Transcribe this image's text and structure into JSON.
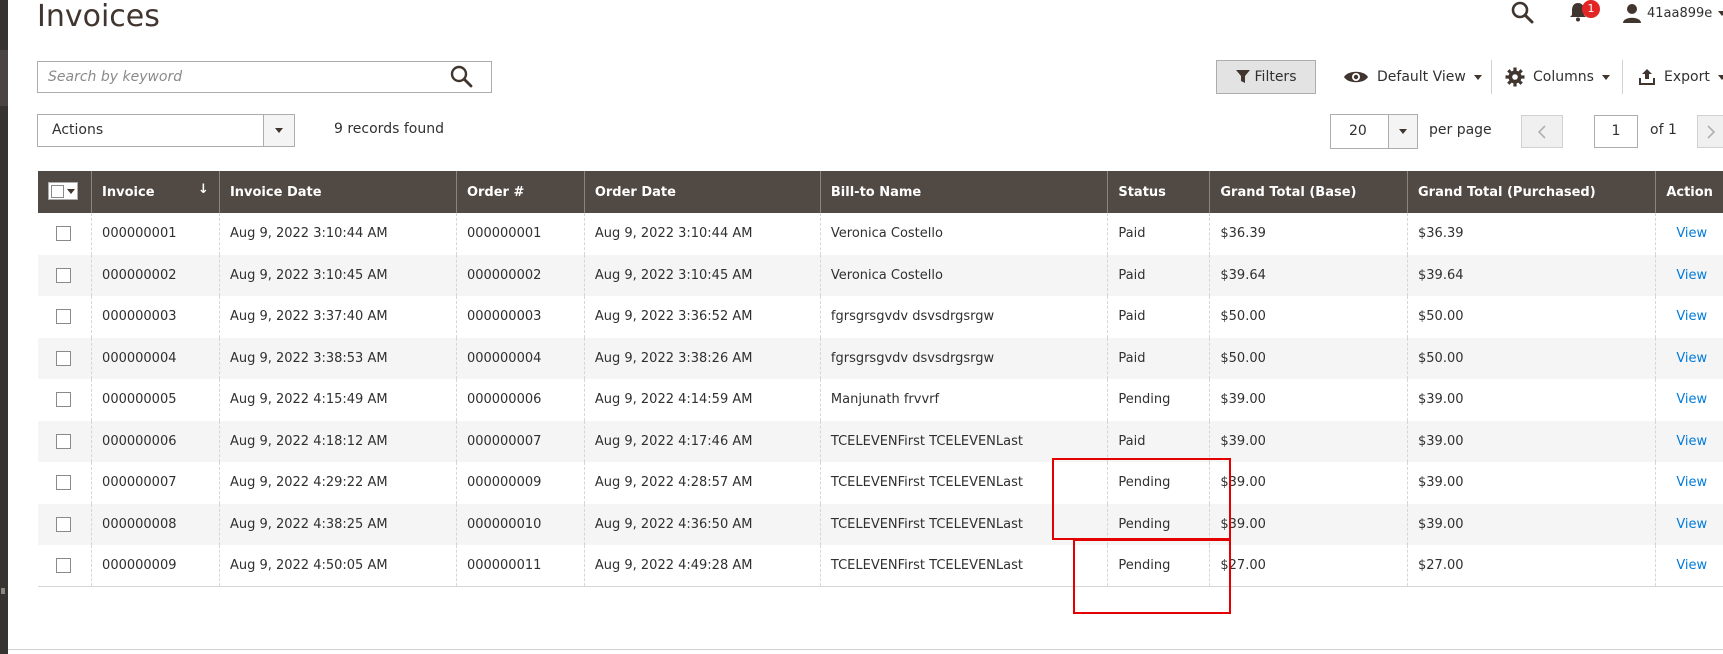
{
  "page": {
    "title": "Invoices"
  },
  "header": {
    "notification_count": "1",
    "user_name": "41aa899e"
  },
  "search": {
    "placeholder": "Search by keyword"
  },
  "toolbar": {
    "filters_label": "Filters",
    "view_label": "Default View",
    "columns_label": "Columns",
    "export_label": "Export"
  },
  "actions": {
    "label": "Actions"
  },
  "records_text": "9 records found",
  "pagination": {
    "per_page_value": "20",
    "per_page_label": "per page",
    "current_page": "1",
    "of_text": "of 1"
  },
  "columns": [
    "Invoice",
    "Invoice Date",
    "Order #",
    "Order Date",
    "Bill-to Name",
    "Status",
    "Grand Total (Base)",
    "Grand Total (Purchased)",
    "Action"
  ],
  "rows": [
    {
      "invoice": "000000001",
      "invoice_date": "Aug 9, 2022 3:10:44 AM",
      "order": "000000001",
      "order_date": "Aug 9, 2022 3:10:44 AM",
      "bill_to": "Veronica Costello",
      "status": "Paid",
      "total_base": "$36.39",
      "total_purchased": "$36.39",
      "action": "View"
    },
    {
      "invoice": "000000002",
      "invoice_date": "Aug 9, 2022 3:10:45 AM",
      "order": "000000002",
      "order_date": "Aug 9, 2022 3:10:45 AM",
      "bill_to": "Veronica Costello",
      "status": "Paid",
      "total_base": "$39.64",
      "total_purchased": "$39.64",
      "action": "View"
    },
    {
      "invoice": "000000003",
      "invoice_date": "Aug 9, 2022 3:37:40 AM",
      "order": "000000003",
      "order_date": "Aug 9, 2022 3:36:52 AM",
      "bill_to": "fgrsgrsgvdv dsvsdrgsrgw",
      "status": "Paid",
      "total_base": "$50.00",
      "total_purchased": "$50.00",
      "action": "View"
    },
    {
      "invoice": "000000004",
      "invoice_date": "Aug 9, 2022 3:38:53 AM",
      "order": "000000004",
      "order_date": "Aug 9, 2022 3:38:26 AM",
      "bill_to": "fgrsgrsgvdv dsvsdrgsrgw",
      "status": "Paid",
      "total_base": "$50.00",
      "total_purchased": "$50.00",
      "action": "View"
    },
    {
      "invoice": "000000005",
      "invoice_date": "Aug 9, 2022 4:15:49 AM",
      "order": "000000006",
      "order_date": "Aug 9, 2022 4:14:59 AM",
      "bill_to": "Manjunath frvvrf",
      "status": "Pending",
      "total_base": "$39.00",
      "total_purchased": "$39.00",
      "action": "View"
    },
    {
      "invoice": "000000006",
      "invoice_date": "Aug 9, 2022 4:18:12 AM",
      "order": "000000007",
      "order_date": "Aug 9, 2022 4:17:46 AM",
      "bill_to": "TCELEVENFirst TCELEVENLast",
      "status": "Paid",
      "total_base": "$39.00",
      "total_purchased": "$39.00",
      "action": "View"
    },
    {
      "invoice": "000000007",
      "invoice_date": "Aug 9, 2022 4:29:22 AM",
      "order": "000000009",
      "order_date": "Aug 9, 2022 4:28:57 AM",
      "bill_to": "TCELEVENFirst TCELEVENLast",
      "status": "Pending",
      "total_base": "$39.00",
      "total_purchased": "$39.00",
      "action": "View"
    },
    {
      "invoice": "000000008",
      "invoice_date": "Aug 9, 2022 4:38:25 AM",
      "order": "000000010",
      "order_date": "Aug 9, 2022 4:36:50 AM",
      "bill_to": "TCELEVENFirst TCELEVENLast",
      "status": "Pending",
      "total_base": "$39.00",
      "total_purchased": "$39.00",
      "action": "View"
    },
    {
      "invoice": "000000009",
      "invoice_date": "Aug 9, 2022 4:50:05 AM",
      "order": "000000011",
      "order_date": "Aug 9, 2022 4:49:28 AM",
      "bill_to": "TCELEVENFirst TCELEVENLast",
      "status": "Pending",
      "total_base": "$27.00",
      "total_purchased": "$27.00",
      "action": "View"
    }
  ],
  "colors": {
    "header_bg": "#514943",
    "link": "#007bdb",
    "badge": "#e22626",
    "highlight": "#e20000"
  }
}
